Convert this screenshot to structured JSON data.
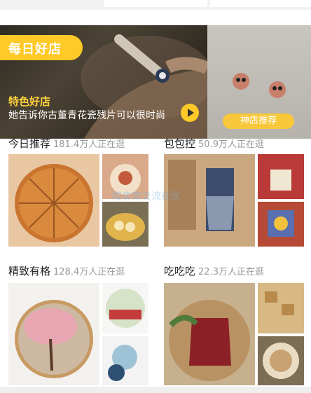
{
  "banner": {
    "badge": "每日好店",
    "title": "特色好店",
    "subtitle": "她告诉你古董青花瓷残片可以很时尚",
    "side_button": "神店推荐"
  },
  "sections": [
    {
      "title": "今日推荐",
      "count": "181.4万人正在逛"
    },
    {
      "title": "包包控",
      "count": "50.9万人正在逛"
    },
    {
      "title": "精致有格",
      "count": "128.4万人正在逛"
    },
    {
      "title": "吃吃吃",
      "count": "22.3万人正在逛"
    }
  ],
  "watermark": "搜卖家交流社区",
  "colors": {
    "accent": "#ffc927",
    "muted": "#999999",
    "text": "#222222"
  }
}
